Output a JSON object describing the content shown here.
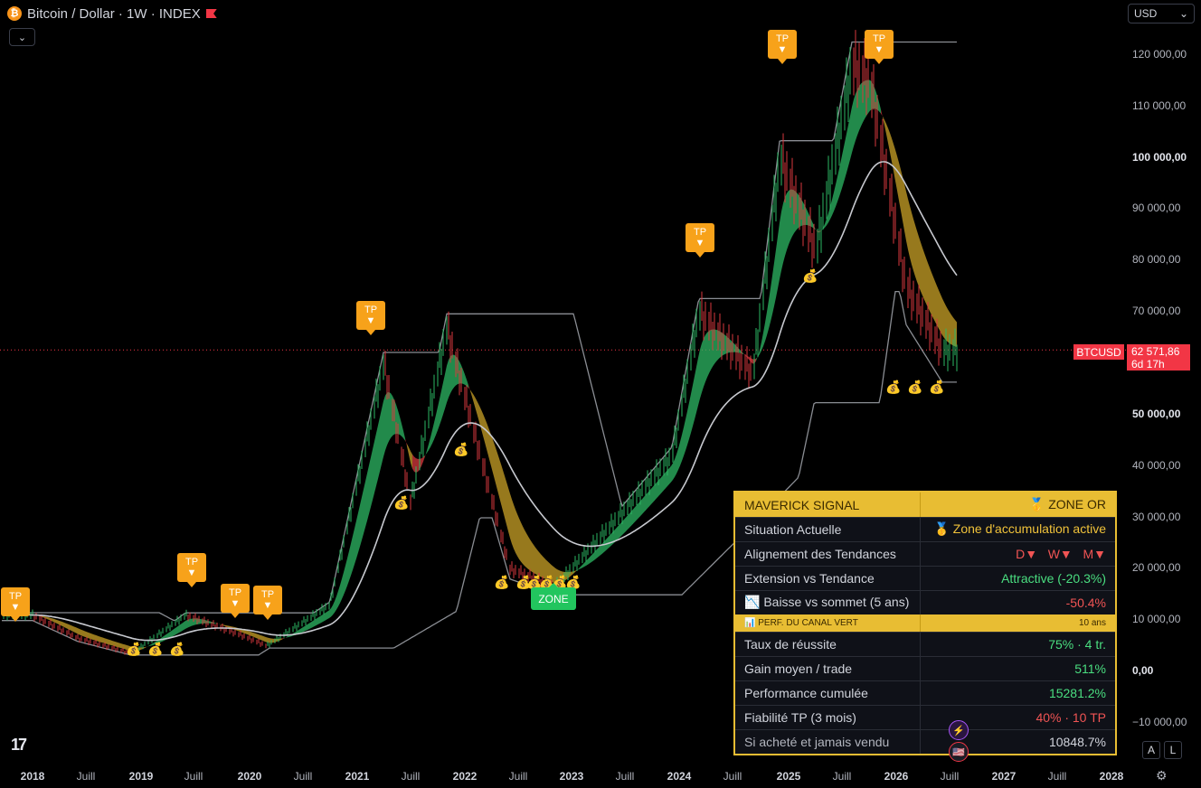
{
  "header": {
    "coin_glyph": "₿",
    "title": "Bitcoin / Dollar · 1W · INDEX",
    "collapse_glyph": "⌄"
  },
  "currency": {
    "value": "USD",
    "chevron": "⌄"
  },
  "y_axis": {
    "labels": [
      "120 000,00",
      "110 000,00",
      "100 000,00",
      "90 000,00",
      "80 000,00",
      "70 000,00",
      "50 000,00",
      "40 000,00",
      "30 000,00",
      "20 000,00",
      "10 000,00",
      "0,00",
      "−10 000,00"
    ],
    "bold_labels": [
      "100 000,00",
      "50 000,00",
      "0,00"
    ]
  },
  "x_axis": {
    "labels": [
      "2018",
      "Juill",
      "2019",
      "Juill",
      "2020",
      "Juill",
      "2021",
      "Juill",
      "2022",
      "Juill",
      "2023",
      "Juill",
      "2024",
      "Juill",
      "2025",
      "Juill",
      "2026",
      "Juill",
      "2027",
      "Juill",
      "2028"
    ],
    "years": [
      "2018",
      "2019",
      "2020",
      "2021",
      "2022",
      "2023",
      "2024",
      "2025",
      "2026",
      "2027",
      "2028"
    ]
  },
  "last_price": {
    "symbol": "BTCUSD",
    "price": "62 571,86",
    "countdown": "6d 17h",
    "value": 62571.86
  },
  "markers": {
    "tp_label": "TP",
    "tp_arrow": "▼",
    "bag_glyph": "💰",
    "zone_label": "ZONE"
  },
  "chart_data": {
    "type": "line",
    "title": "Bitcoin / Dollar · 1W · INDEX",
    "series": [
      {
        "name": "BTCUSD",
        "x": [
          "2018-01",
          "2018-06",
          "2018-12",
          "2019-06",
          "2019-12",
          "2020-03",
          "2020-10",
          "2021-04",
          "2021-07",
          "2021-11",
          "2022-06",
          "2022-11",
          "2023-06",
          "2023-12",
          "2024-03",
          "2024-09",
          "2024-12",
          "2025-04",
          "2025-08",
          "2025-10",
          "2026-02",
          "2026-06"
        ],
        "values": [
          11000,
          6500,
          3500,
          11000,
          7200,
          5000,
          13000,
          60000,
          33000,
          67000,
          20000,
          16500,
          30000,
          42000,
          70000,
          58000,
          100000,
          82000,
          118000,
          115000,
          75000,
          62571.86
        ]
      }
    ],
    "ylim": [
      -12000,
      127000
    ],
    "grid": false,
    "colors": {
      "up": "#2db864",
      "down": "#d8393e",
      "gold": "#c9a227",
      "band": "#8a8d93",
      "basis": "#c7c9cf"
    }
  },
  "signal_table": {
    "title": "MAVERICK SIGNAL",
    "zone": "🥇 ZONE OR",
    "rows": [
      {
        "label": "Situation Actuelle",
        "value": "🥇 Zone d'accumulation active"
      },
      {
        "label": "Alignement des Tendances",
        "d": "D▼",
        "w": "W▼",
        "m": "M▼"
      },
      {
        "label": "Extension vs Tendance",
        "value": "Attractive (-20.3%)"
      },
      {
        "label": "📉 Baisse vs sommet (5 ans)",
        "value": "-50.4%"
      }
    ],
    "section": {
      "label": "📊 PERF. DU CANAL VERT",
      "value": "10 ans"
    },
    "perf_rows": [
      {
        "label": "Taux de réussite",
        "value": "75% · 4 tr."
      },
      {
        "label": "Gain moyen / trade",
        "value": "511%"
      },
      {
        "label": "Performance cumulée",
        "value": "15281.2%"
      },
      {
        "label": "Fiabilité TP (3 mois)",
        "value": "40% · 10 TP"
      },
      {
        "label": "Si acheté et jamais vendu",
        "value": "10848.7%"
      }
    ]
  },
  "footer": {
    "logo": "17",
    "auto_label": "A",
    "log_label": "L",
    "settings_glyph": "⚙"
  },
  "events": {
    "lightning_glyph": "⚡",
    "flag_glyph": "🇺🇸"
  }
}
